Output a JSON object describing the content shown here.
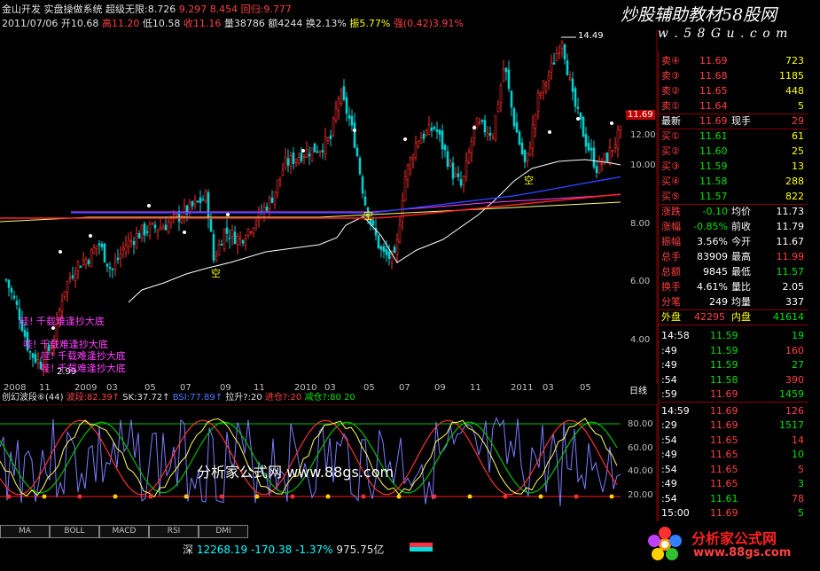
{
  "header": {
    "title_text": "金山开发  实盘操做系统  超级无限:8.726",
    "line1_tail": "9.297  8.454  回归:9.777",
    "line2_date": "2011/07/06",
    "open_label": "开10.68",
    "high_label": "高11.20",
    "low_label": "低10.58",
    "close_label": "收11.16",
    "volume_label": "量38786",
    "amount_label": "额4244",
    "turnover_label": "换2.13%",
    "amplitude_label": "振5.77%",
    "strength_label": "强(0.42)3.91%"
  },
  "main_chart": {
    "peak_label": "14.49",
    "low_label": "2.99",
    "current_price": "11.69",
    "y_labels": [
      "12.00",
      "10.00",
      "8.00",
      "6.00",
      "4.00"
    ],
    "signal_texts": [
      "哇!  千载难逢抄大底",
      "哇!  千载难逢抄大底",
      "哇!  千载难逢抄大底",
      "哇!  千载难逢抄大底"
    ],
    "kong_label": "空",
    "x_labels": [
      "2008",
      "11",
      "2009",
      "03",
      "05",
      "07",
      "09",
      "11",
      "2010",
      "03",
      "05",
      "07",
      "09",
      "11",
      "2011",
      "03",
      "05",
      "日线"
    ]
  },
  "oscillator": {
    "name": "创幻波段⑥(44)",
    "items": [
      "波段:82.39↑",
      "SK:37.72↑",
      "BSI:77.89↑",
      "拉升?:20",
      "进仓?:20",
      "减仓?:80",
      "20"
    ],
    "y_labels": [
      "80.00",
      "60.00",
      "40.00",
      "20.00"
    ]
  },
  "tabs": [
    "MA",
    "BOLL",
    "MACD",
    "RSI",
    "DMI"
  ],
  "status_bar": {
    "market": "深",
    "index_value": "12268.19",
    "change": "-170.38",
    "change_pct": "-1.37%",
    "amount": "975.75亿"
  },
  "quote": {
    "sells": [
      {
        "label": "卖④",
        "price": "11.69",
        "vol": "723"
      },
      {
        "label": "卖③",
        "price": "11.68",
        "vol": "1185"
      },
      {
        "label": "卖②",
        "price": "11.65",
        "vol": "448"
      },
      {
        "label": "卖①",
        "price": "11.64",
        "vol": "5"
      }
    ],
    "latest": {
      "label": "最新",
      "price": "11.69",
      "label2": "现手",
      "vol": "29"
    },
    "buys": [
      {
        "label": "买①",
        "price": "11.61",
        "vol": "61"
      },
      {
        "label": "买②",
        "price": "11.60",
        "vol": "25"
      },
      {
        "label": "买③",
        "price": "11.59",
        "vol": "13"
      },
      {
        "label": "买④",
        "price": "11.58",
        "vol": "288"
      },
      {
        "label": "买⑤",
        "price": "11.57",
        "vol": "822"
      }
    ],
    "stats": [
      {
        "k1": "涨跌",
        "v1": "-0.10",
        "k2": "均价",
        "v2": "11.73"
      },
      {
        "k1": "涨幅",
        "v1": "-0.85%",
        "k2": "前收",
        "v2": "11.79"
      },
      {
        "k1": "振幅",
        "v1": "3.56%",
        "k2": "今开",
        "v2": "11.67"
      },
      {
        "k1": "总手",
        "v1": "83909",
        "k2": "最高",
        "v2": "11.99"
      },
      {
        "k1": "总额",
        "v1": "9845",
        "k2": "最低",
        "v2": "11.57"
      },
      {
        "k1": "换手",
        "v1": "4.61%",
        "k2": "量比",
        "v2": "2.05"
      },
      {
        "k1": "分笔",
        "v1": "249",
        "k2": "均量",
        "v2": "337"
      }
    ],
    "outer": {
      "k1": "外盘",
      "v1": "42295",
      "k2": "内盘",
      "v2": "41614"
    },
    "ticks": [
      {
        "t": "14:58",
        "p": "11.59",
        "v": "19"
      },
      {
        "t": ":49",
        "p": "11.59",
        "v": "160"
      },
      {
        "t": ":49",
        "p": "11.59",
        "v": "27"
      },
      {
        "t": ":54",
        "p": "11.58",
        "v": "390"
      },
      {
        "t": ":59",
        "p": "11.69",
        "v": "1459"
      },
      {
        "t": "14:59",
        "p": "11.69",
        "v": "126"
      },
      {
        "t": ":29",
        "p": "11.69",
        "v": "1517"
      },
      {
        "t": ":54",
        "p": "11.65",
        "v": "14"
      },
      {
        "t": ":49",
        "p": "11.65",
        "v": "10"
      },
      {
        "t": ":54",
        "p": "11.65",
        "v": "5"
      },
      {
        "t": ":49",
        "p": "11.65",
        "v": "3"
      },
      {
        "t": ":54",
        "p": "11.61",
        "v": "78"
      },
      {
        "t": "15:00",
        "p": "11.69",
        "v": "5"
      }
    ]
  },
  "watermarks": {
    "top": "炒股辅助教材58股网",
    "url": "w w w . 5 8 G u . c o m",
    "mid": "分析家公式网  www.88gs.com",
    "brand": "分析家公式网",
    "brand_url": "www.88gs.com"
  },
  "colors": {
    "up": "#ff3030",
    "down": "#00d0d0",
    "ma_white": "#ffffff",
    "ma_yellow": "#ffff80",
    "ma_blue": "#3040ff",
    "ma_red": "#ff2020"
  }
}
